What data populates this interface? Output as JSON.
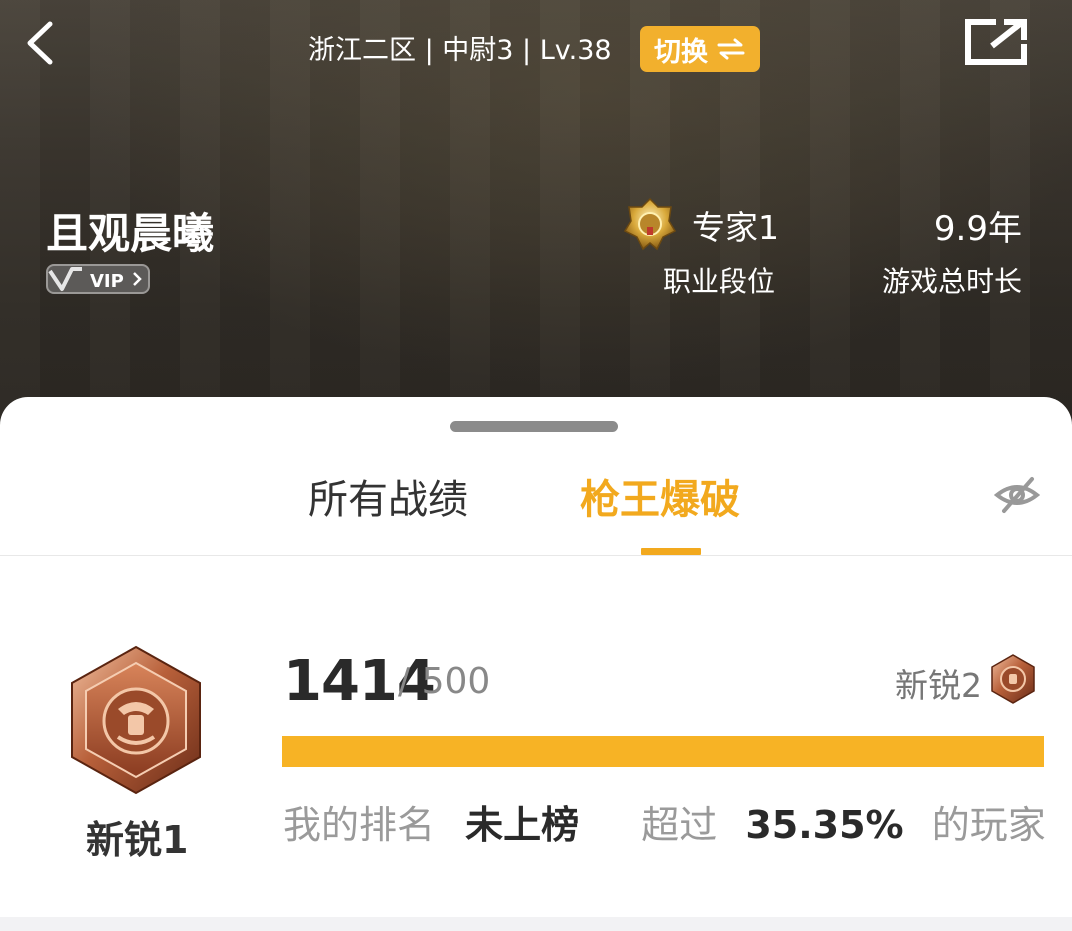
{
  "topbar": {
    "server_info": "浙江二区 | 中尉3 | Lv.38",
    "switch_label": "切换"
  },
  "profile": {
    "username": "且观晨曦",
    "vip_label": "VIP",
    "rank_value": "专家1",
    "rank_label": "职业段位",
    "playtime_value": "9.9年",
    "playtime_label": "游戏总时长"
  },
  "tabs": [
    {
      "label": "所有战绩",
      "active": false
    },
    {
      "label": "枪王爆破",
      "active": true
    }
  ],
  "stats": {
    "current_rank": "新锐1",
    "score": "1414",
    "score_total": "/ 500",
    "next_rank": "新锐2",
    "progress_fraction": 1.0,
    "ranking_label": "我的排名",
    "ranking_value": "未上榜",
    "exceed_label": "超过",
    "exceed_value": "35.35%",
    "exceed_suffix": "的玩家"
  },
  "colors": {
    "accent": "#f2a91e",
    "progress": "#f7b325",
    "hero_bg": "#332f28"
  },
  "icons": {
    "back": "chevron-left-icon",
    "share": "share-icon",
    "hide": "eye-off-icon",
    "switch": "swap-icon"
  }
}
